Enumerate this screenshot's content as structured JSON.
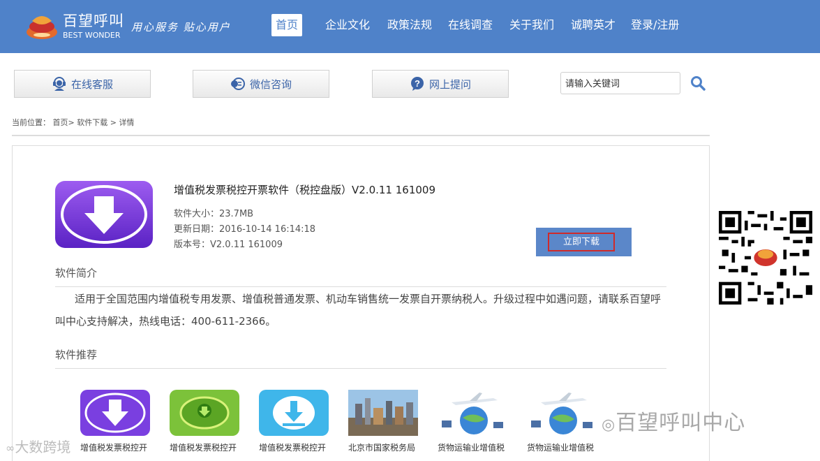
{
  "header": {
    "brand_cn": "百望呼叫",
    "brand_en": "BEST WONDER",
    "slogan": "用心服务 贴心用户",
    "nav": [
      "首页",
      "企业文化",
      "政策法规",
      "在线调查",
      "关于我们",
      "诚聘英才",
      "登录/注册"
    ],
    "active_nav": "首页"
  },
  "quick": {
    "online_service": "在线客服",
    "wechat": "微信咨询",
    "ask": "网上提问"
  },
  "search": {
    "placeholder": "请输入关键词"
  },
  "breadcrumb": {
    "prefix": "当前位置：",
    "home": "首页>",
    "downloads": "软件下载",
    "sep": ">",
    "detail": "详情"
  },
  "software": {
    "title": "增值税发票税控开票软件（税控盘版）V2.0.11 161009",
    "size": "软件大小：23.7MB",
    "date": "更新日期：2016-10-14 16:14:18",
    "version": "版本号：V2.0.11 161009",
    "download_label": "立即下载"
  },
  "intro": {
    "title": "软件简介",
    "text": "适用于全国范围内增值税专用发票、增值税普通发票、机动车销售统一发票自开票纳税人。升级过程中如遇问题，请联系百望呼叫中心支持解决，热线电话：400-611-2366。"
  },
  "recommend": {
    "title": "软件推荐",
    "items": [
      {
        "caption": "增值税发票税控开",
        "icon": "purple-download-icon"
      },
      {
        "caption": "增值税发票税控开",
        "icon": "green-download-icon"
      },
      {
        "caption": "增值税发票税控开",
        "icon": "blue-download-icon"
      },
      {
        "caption": "北京市国家税务局",
        "icon": "city-photo"
      },
      {
        "caption": "货物运输业增值税",
        "icon": "airplane-globe-photo"
      },
      {
        "caption": "货物运输业增值税",
        "icon": "airplane-globe-photo"
      }
    ]
  },
  "watermarks": {
    "wechat": "百望呼叫中心",
    "bigdata": "大数跨境"
  },
  "colors": {
    "header": "#4f82c9",
    "button": "#5b87c9",
    "highlight": "#d02a2a"
  }
}
